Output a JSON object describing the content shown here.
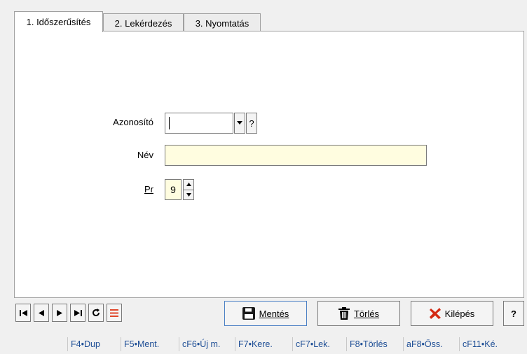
{
  "tabs": [
    {
      "label": "1. Időszerűsítés",
      "active": true
    },
    {
      "label": "2. Lekérdezés",
      "active": false
    },
    {
      "label": "3. Nyomtatás",
      "active": false
    }
  ],
  "form": {
    "azonosito": {
      "label": "Azonosító",
      "value": "",
      "help": "?"
    },
    "nev": {
      "label": "Név",
      "value": ""
    },
    "pr": {
      "label": "Pr",
      "value": "9"
    }
  },
  "actions": {
    "save_label": "Mentés",
    "delete_label": "Törlés",
    "exit_label": "Kilépés",
    "help_label": "?"
  },
  "shortcuts": [
    "F4•Dup",
    "F5•Ment.",
    "cF6•Új m.",
    "F7•Kere.",
    "cF7•Lek.",
    "F8•Törlés",
    "aF8•Öss.",
    "cF11•Ké."
  ],
  "colors": {
    "required_field": "#fffde0",
    "shortcut_text": "#1f4f96",
    "exit_icon": "#d42a14"
  }
}
